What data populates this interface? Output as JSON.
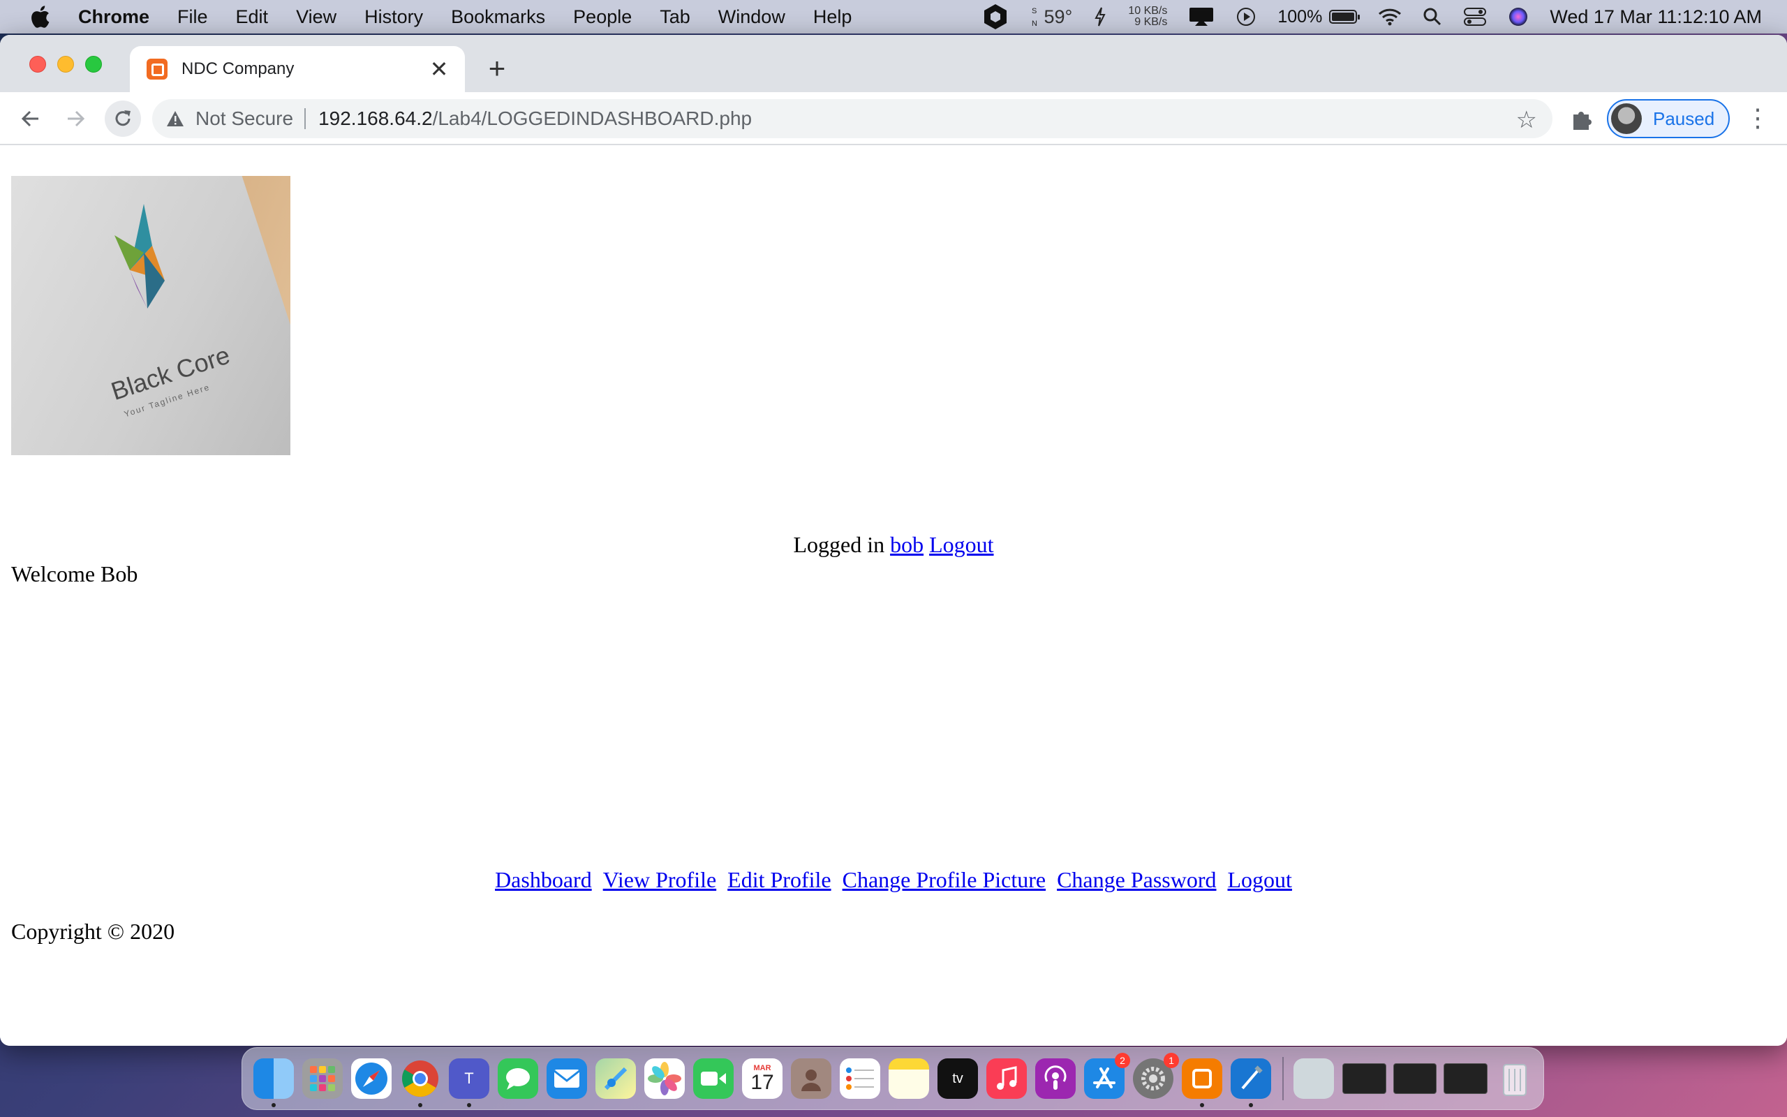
{
  "menubar": {
    "app_name": "Chrome",
    "menus": [
      "File",
      "Edit",
      "View",
      "History",
      "Bookmarks",
      "People",
      "Tab",
      "Window",
      "Help"
    ],
    "weather": "59°",
    "net_up": "10 KB/s",
    "net_down": "9 KB/s",
    "battery": "100%",
    "battery_level": 1.0,
    "clock": "Wed 17 Mar  11:12:10 AM"
  },
  "browser": {
    "tab_title": "NDC Company",
    "security_label": "Not Secure",
    "url_host": "192.168.64.2",
    "url_path": "/Lab4/LOGGEDINDASHBOARD.php",
    "profile_label": "Paused",
    "colors": {
      "accent": "#1a73e8",
      "tabstrip": "#dee1e6"
    }
  },
  "page": {
    "logo_text": "Black Core",
    "logo_tagline": "Your Tagline Here",
    "logged_in_prefix": "Logged in",
    "username_link": "bob",
    "logout_link": "Logout",
    "welcome": "Welcome Bob",
    "footer_links": [
      "Dashboard",
      "View Profile",
      "Edit Profile",
      "Change Profile Picture",
      "Change Password",
      "Logout"
    ],
    "copyright": "Copyright © 2020"
  },
  "dock": {
    "calendar_month": "MAR",
    "calendar_day": "17",
    "app_store_badge": "2",
    "system_prefs_badge": "1"
  }
}
